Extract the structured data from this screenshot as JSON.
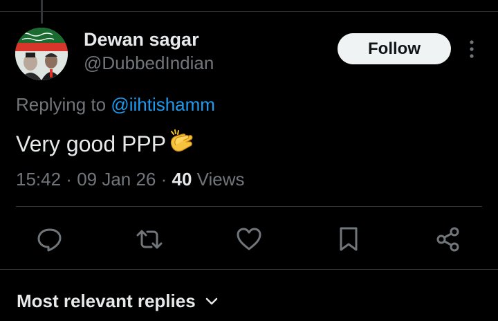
{
  "user": {
    "display_name": "Dewan sagar",
    "handle": "@DubbedIndian"
  },
  "follow_label": "Follow",
  "reply": {
    "prefix": "Replying to ",
    "mention": "@iihtishamm"
  },
  "tweet": {
    "text": "Very good PPP",
    "emoji": "clapping-hands"
  },
  "meta": {
    "time": "15:42",
    "date": "09 Jan 26",
    "separator": " · ",
    "view_count": "40",
    "views_label": " Views"
  },
  "actions": [
    "reply",
    "retweet",
    "like",
    "bookmark",
    "share"
  ],
  "sort": {
    "label": "Most relevant replies"
  },
  "colors": {
    "background": "#000000",
    "text": "#e7e9ea",
    "secondary": "#71767b",
    "link": "#1d9bf0",
    "divider": "#2f3336",
    "follow_bg": "#eff3f4"
  }
}
